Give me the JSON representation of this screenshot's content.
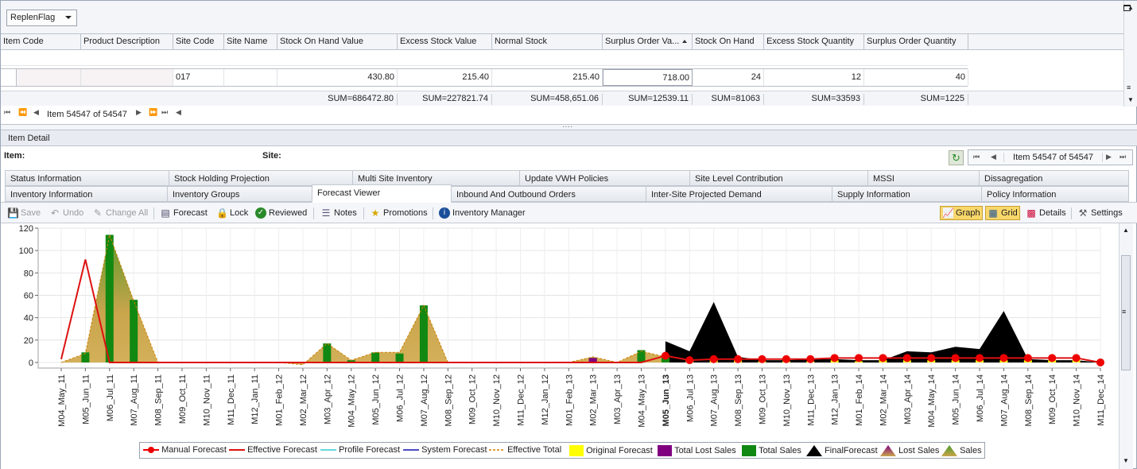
{
  "toolbar_top": {
    "replen_flag": "ReplenFlag"
  },
  "grid": {
    "columns": [
      "Item Code",
      "Product Description",
      "Site Code",
      "Site Name",
      "Stock On Hand Value",
      "Excess Stock Value",
      "Normal Stock",
      "Surplus Order Va...",
      "Stock On Hand",
      "Excess Stock Quantity",
      "Surplus Order Quantity"
    ],
    "row": {
      "site_code": "017",
      "stock_on_hand_value": "430.80",
      "excess_stock_value": "215.40",
      "normal_stock": "215.40",
      "surplus_order_value": "718.00",
      "stock_on_hand": "24",
      "excess_stock_quantity": "12",
      "surplus_order_quantity": "40"
    },
    "sums": {
      "stock_on_hand_value": "SUM=686472.80",
      "excess_stock_value": "SUM=227821.74",
      "normal_stock": "SUM=458,651.06",
      "surplus_order_value": "SUM=12539.11",
      "stock_on_hand": "SUM=81063",
      "excess_stock_quantity": "SUM=33593",
      "surplus_order_quantity": "SUM=1225"
    },
    "nav_label": "Item 54547 of 54547"
  },
  "detail": {
    "title": "Item Detail",
    "item_label": "Item:",
    "site_label": "Site:",
    "nav_label": "Item 54547 of 54547",
    "tabs_row1": [
      "Status Information",
      "Stock Holding Projection",
      "Multi Site Inventory",
      "Update VWH Policies",
      "Site Level Contribution",
      "MSSI",
      "Dissagregation"
    ],
    "tabs_row2": [
      "Inventory Information",
      "Inventory Groups",
      "Forecast Viewer",
      "Inbound And Outbound Orders",
      "Inter-Site Projected Demand",
      "Supply Information",
      "Policy Information"
    ]
  },
  "toolbar": {
    "save": "Save",
    "undo": "Undo",
    "change_all": "Change All",
    "forecast": "Forecast",
    "lock": "Lock",
    "reviewed": "Reviewed",
    "notes": "Notes",
    "promotions": "Promotions",
    "inventory_manager": "Inventory Manager",
    "graph": "Graph",
    "grid": "Grid",
    "details": "Details",
    "settings": "Settings"
  },
  "colors": {
    "effective_forecast": "#dd1111",
    "manual_forecast": "#ee0000",
    "total_sales": "#118811",
    "final_forecast": "#000000",
    "sales": "#c9a54c",
    "original_forecast": "#ffff00",
    "total_lost_sales": "#800080",
    "profile_forecast": "#33cccc",
    "system_forecast": "#1111aa",
    "effective_total": "#d08000"
  },
  "chart_data": {
    "type": "line",
    "ylim": [
      -5,
      120
    ],
    "yticks": [
      0,
      20,
      40,
      60,
      80,
      100,
      120
    ],
    "categories": [
      "M04_May_11",
      "M05_Jun_11",
      "M06_Jul_11",
      "M07_Aug_11",
      "M08_Sep_11",
      "M09_Oct_11",
      "M10_Nov_11",
      "M11_Dec_11",
      "M12_Jan_11",
      "M01_Feb_12",
      "M02_Mar_12",
      "M03_Apr_12",
      "M04_May_12",
      "M05_Jun_12",
      "M06_Jul_12",
      "M07_Aug_12",
      "M08_Sep_12",
      "M09_Oct_12",
      "M10_Nov_12",
      "M11_Dec_12",
      "M12_Jan_12",
      "M01_Feb_13",
      "M02_Mar_13",
      "M03_Apr_13",
      "M04_May_13",
      "M05_Jun_13",
      "M06_Jul_13",
      "M07_Aug_13",
      "M08_Sep_13",
      "M09_Oct_13",
      "M10_Nov_13",
      "M11_Dec_13",
      "M12_Jan_13",
      "M01_Feb_14",
      "M02_Mar_14",
      "M03_Apr_14",
      "M04_May_14",
      "M05_Jun_14",
      "M06_Jul_14",
      "M07_Aug_14",
      "M08_Sep_14",
      "M09_Oct_14",
      "M10_Nov_14",
      "M11_Dec_14"
    ],
    "current_period": "M05_Jun_13",
    "series": [
      {
        "name": "Sales",
        "values": [
          0,
          8,
          114,
          55,
          0,
          0,
          0,
          0,
          0,
          0,
          -2,
          17,
          2,
          9,
          9,
          51,
          0,
          0,
          0,
          0,
          0,
          0,
          5,
          0,
          10,
          5,
          null,
          null,
          null,
          null,
          null,
          null,
          null,
          null,
          null,
          null,
          null,
          null,
          null,
          null,
          null,
          null,
          null,
          null
        ]
      },
      {
        "name": "Total Sales",
        "values": [
          0,
          9,
          114,
          56,
          0,
          0,
          0,
          0,
          0,
          0,
          0,
          17,
          2,
          9,
          8,
          51,
          0,
          0,
          0,
          0,
          0,
          0,
          4,
          0,
          11,
          4,
          null,
          null,
          null,
          null,
          null,
          null,
          null,
          null,
          null,
          null,
          null,
          null,
          null,
          null,
          null,
          null,
          null,
          null
        ]
      },
      {
        "name": "Effective Forecast",
        "values": [
          3,
          92,
          0,
          0,
          0,
          0,
          0,
          0,
          0,
          0,
          0,
          0,
          0,
          0,
          0,
          0,
          0,
          0,
          0,
          0,
          0,
          0,
          0,
          0,
          0,
          6,
          2,
          3,
          3,
          3,
          3,
          3,
          4,
          4,
          4,
          4,
          4,
          4,
          4,
          4,
          4,
          4,
          4,
          0
        ]
      },
      {
        "name": "Manual Forecast",
        "values": [
          null,
          null,
          null,
          null,
          null,
          null,
          null,
          null,
          null,
          null,
          null,
          null,
          null,
          null,
          null,
          null,
          null,
          null,
          null,
          null,
          null,
          null,
          null,
          null,
          null,
          6,
          2,
          3,
          3,
          3,
          3,
          3,
          4,
          4,
          4,
          4,
          4,
          4,
          4,
          4,
          4,
          4,
          4,
          0
        ]
      },
      {
        "name": "FinalForecast",
        "values": [
          null,
          null,
          null,
          null,
          null,
          null,
          null,
          null,
          null,
          null,
          null,
          null,
          null,
          null,
          null,
          null,
          null,
          null,
          null,
          null,
          null,
          null,
          null,
          null,
          null,
          19,
          10,
          54,
          5,
          2,
          2,
          3,
          3,
          2,
          2,
          10,
          9,
          14,
          12,
          46,
          3,
          2,
          2,
          0
        ]
      },
      {
        "name": "Original Forecast",
        "values": [
          null,
          null,
          null,
          null,
          null,
          null,
          null,
          null,
          null,
          null,
          null,
          null,
          null,
          null,
          null,
          null,
          null,
          null,
          null,
          null,
          null,
          null,
          null,
          null,
          null,
          4,
          2,
          2,
          2,
          1,
          1,
          1,
          2,
          1,
          2,
          2,
          2,
          2,
          2,
          2,
          2,
          2,
          2,
          0
        ]
      },
      {
        "name": "Total Lost Sales",
        "values": [
          0,
          0,
          0,
          0,
          0,
          0,
          0,
          0,
          0,
          0,
          0,
          0,
          0,
          0,
          0,
          0,
          0,
          0,
          0,
          0,
          0,
          0,
          4,
          0,
          0,
          0,
          null,
          null,
          null,
          null,
          null,
          null,
          null,
          null,
          null,
          null,
          null,
          null,
          null,
          null,
          null,
          null,
          null,
          null
        ]
      }
    ],
    "legend": [
      "Manual Forecast",
      "Effective Forecast",
      "Profile Forecast",
      "System Forecast",
      "Effective Total",
      "Original Forecast",
      "Total Lost Sales",
      "Total Sales",
      "FinalForecast",
      "Lost Sales",
      "Sales"
    ]
  }
}
